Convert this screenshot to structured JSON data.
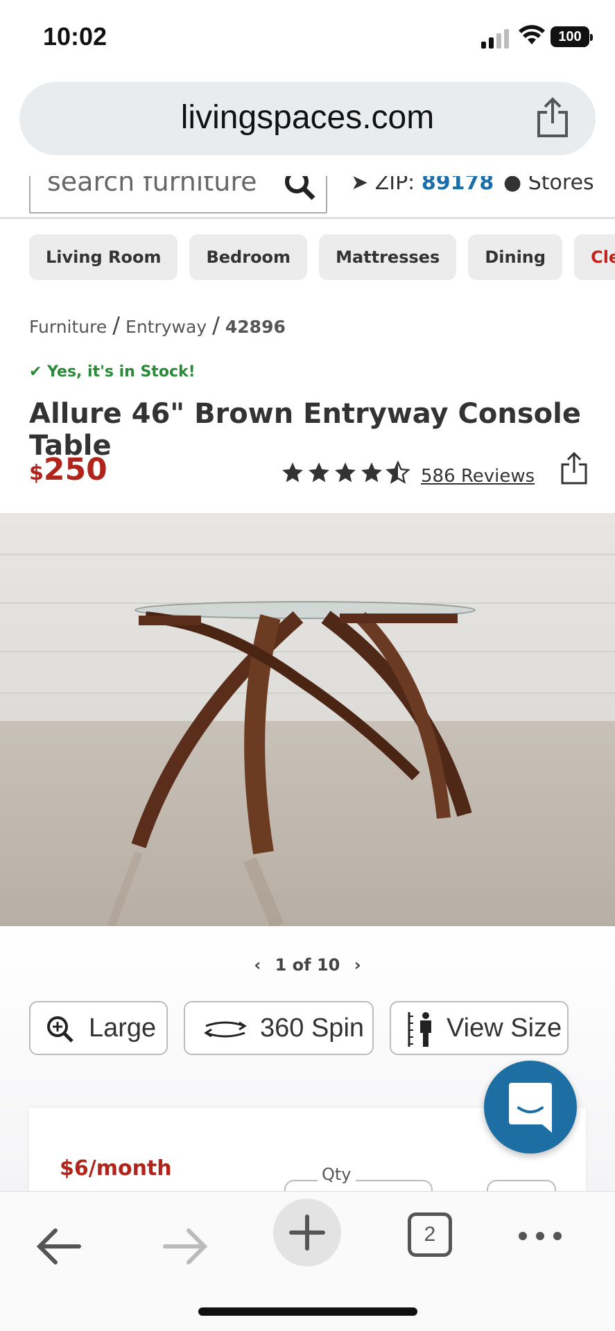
{
  "status_bar": {
    "time": "10:02",
    "battery": "100"
  },
  "browser": {
    "url": "livingspaces.com",
    "tab_count": "2"
  },
  "site_header": {
    "search_placeholder": "search furniture",
    "zip_label": "ZIP:",
    "zip_value": "89178",
    "stores_label": "Stores"
  },
  "categories": [
    "Living Room",
    "Bedroom",
    "Mattresses",
    "Dining",
    "Clearance"
  ],
  "breadcrumb": [
    "Furniture",
    "Entryway",
    "42896"
  ],
  "product": {
    "stock_text": "Yes, it's in Stock!",
    "title": "Allure 46\" Brown Entryway Console Table",
    "currency": "$",
    "price": "250",
    "rating": 4.5,
    "reviews_label": "586 Reviews",
    "image_counter": "1 of 10"
  },
  "actions": {
    "large_label": "Large",
    "spin_label": "360 Spin",
    "size_label": "View Size"
  },
  "purchase": {
    "monthly_label": "$6/month",
    "qty_label": "Qty"
  },
  "colors": {
    "price_red": "#b1241c",
    "stock_green": "#2a8a3a",
    "zip_blue": "#1b6ea8",
    "chat_blue": "#1d6fa3"
  },
  "icons": [
    "signal-icon",
    "wifi-icon",
    "battery-icon",
    "share-icon",
    "search-icon",
    "location-arrow-icon",
    "map-pin-icon",
    "check-icon",
    "star-icon",
    "zoom-icon",
    "spin-icon",
    "person-ruler-icon",
    "chat-icon",
    "back-arrow-icon",
    "forward-arrow-icon",
    "plus-icon",
    "tabs-icon",
    "more-icon"
  ]
}
